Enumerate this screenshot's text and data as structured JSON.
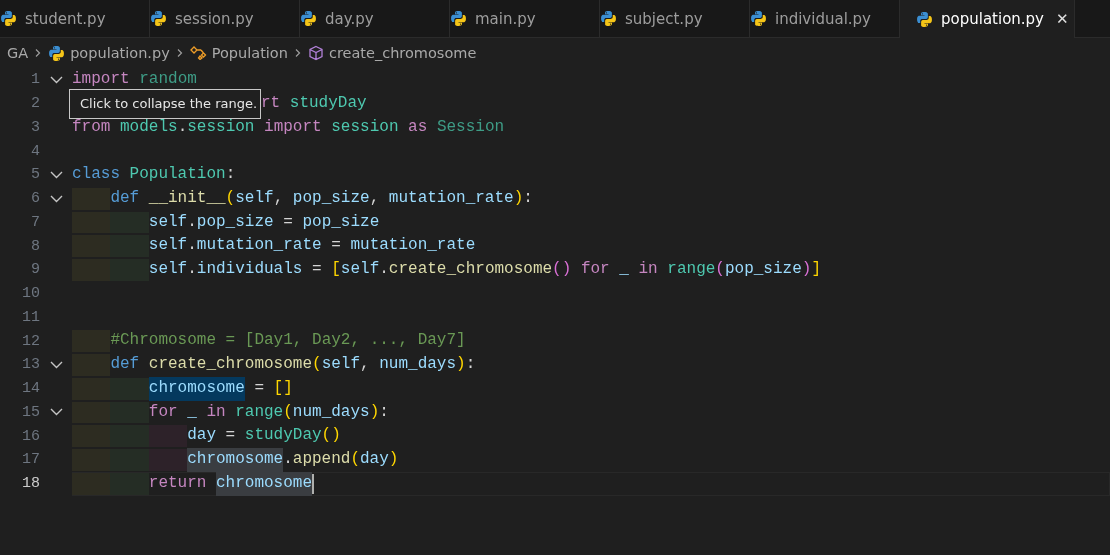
{
  "tabs": [
    {
      "label": "student.py",
      "selected": false
    },
    {
      "label": "session.py",
      "selected": false
    },
    {
      "label": "day.py",
      "selected": false
    },
    {
      "label": "main.py",
      "selected": false
    },
    {
      "label": "subject.py",
      "selected": false
    },
    {
      "label": "individual.py",
      "selected": false
    },
    {
      "label": "population.py",
      "selected": true,
      "close": "✕"
    }
  ],
  "breadcrumb": [
    {
      "kind": "folder",
      "label": "GA"
    },
    {
      "kind": "file",
      "label": "population.py"
    },
    {
      "kind": "class",
      "label": "Population"
    },
    {
      "kind": "method",
      "label": "create_chromosome"
    }
  ],
  "lines": [
    {
      "number": "1",
      "foldable": true,
      "current": false,
      "tokens": [
        {
          "t": "import ",
          "kind": "keyword"
        },
        {
          "t": "random",
          "kind": "dim"
        }
      ]
    },
    {
      "number": "2",
      "foldable": false,
      "current": false,
      "tooltip": "Click to collapse the range.",
      "tokens": [
        {
          "t": "rt ",
          "kind": "keyword"
        },
        {
          "t": "studyDay",
          "kind": "type"
        }
      ]
    },
    {
      "number": "3",
      "foldable": false,
      "current": false,
      "tokens": [
        {
          "t": "from ",
          "kind": "keyword"
        },
        {
          "t": "models",
          "kind": "type"
        },
        {
          "t": ".",
          "kind": "plain"
        },
        {
          "t": "session ",
          "kind": "type"
        },
        {
          "t": "import ",
          "kind": "keyword"
        },
        {
          "t": "session ",
          "kind": "type"
        },
        {
          "t": "as ",
          "kind": "keyword"
        },
        {
          "t": "Session",
          "kind": "dim"
        }
      ]
    },
    {
      "number": "4",
      "foldable": false,
      "current": false
    },
    {
      "number": "5",
      "foldable": true,
      "current": false,
      "tokens": [
        {
          "t": "class ",
          "kind": "storage"
        },
        {
          "t": "Population",
          "kind": "type"
        },
        {
          "t": ":",
          "kind": "plain"
        }
      ],
      "children": [
        {
          "number": "6",
          "foldable": true,
          "current": false,
          "tokens": [
            {
              "t": "def ",
              "kind": "storage"
            },
            {
              "t": "__init__",
              "kind": "func"
            },
            {
              "t": "(",
              "kind": "bracket1"
            },
            {
              "t": "self",
              "kind": "var"
            },
            {
              "t": ", ",
              "kind": "plain"
            },
            {
              "t": "pop_size",
              "kind": "var"
            },
            {
              "t": ", ",
              "kind": "plain"
            },
            {
              "t": "mutation_rate",
              "kind": "var"
            },
            {
              "t": ")",
              "kind": "bracket1"
            },
            {
              "t": ":",
              "kind": "plain"
            }
          ],
          "children": [
            {
              "number": "7",
              "foldable": false,
              "current": false,
              "tokens": [
                {
                  "t": "self",
                  "kind": "var"
                },
                {
                  "t": ".",
                  "kind": "plain"
                },
                {
                  "t": "pop_size",
                  "kind": "var"
                },
                {
                  "t": " = ",
                  "kind": "plain"
                },
                {
                  "t": "pop_size",
                  "kind": "var"
                }
              ]
            },
            {
              "number": "8",
              "foldable": false,
              "current": false,
              "tokens": [
                {
                  "t": "self",
                  "kind": "var"
                },
                {
                  "t": ".",
                  "kind": "plain"
                },
                {
                  "t": "mutation_rate",
                  "kind": "var"
                },
                {
                  "t": " = ",
                  "kind": "plain"
                },
                {
                  "t": "mutation_rate",
                  "kind": "var"
                }
              ]
            },
            {
              "number": "9",
              "foldable": false,
              "current": false,
              "tokens": [
                {
                  "t": "self",
                  "kind": "var"
                },
                {
                  "t": ".",
                  "kind": "plain"
                },
                {
                  "t": "individuals",
                  "kind": "var"
                },
                {
                  "t": " = ",
                  "kind": "plain"
                },
                {
                  "t": "[",
                  "kind": "bracket1"
                },
                {
                  "t": "self",
                  "kind": "var"
                },
                {
                  "t": ".",
                  "kind": "plain"
                },
                {
                  "t": "create_chromosome",
                  "kind": "func"
                },
                {
                  "t": "() ",
                  "kind": "bracket2"
                },
                {
                  "t": "for ",
                  "kind": "keyword"
                },
                {
                  "t": "_ ",
                  "kind": "var"
                },
                {
                  "t": "in ",
                  "kind": "keyword"
                },
                {
                  "t": "range",
                  "kind": "type"
                },
                {
                  "t": "(",
                  "kind": "bracket2"
                },
                {
                  "t": "pop_size",
                  "kind": "var"
                },
                {
                  "t": ")",
                  "kind": "bracket2"
                },
                {
                  "t": "]",
                  "kind": "bracket1"
                }
              ]
            }
          ]
        },
        {
          "number": "10",
          "foldable": false,
          "current": false
        },
        {
          "number": "11",
          "foldable": false,
          "current": false
        },
        {
          "number": "12",
          "foldable": false,
          "current": false,
          "tokens": [
            {
              "t": "#Chromosome = [Day1, Day2, ..., Day7]",
              "kind": "comment"
            }
          ]
        },
        {
          "number": "13",
          "foldable": true,
          "current": false,
          "tokens": [
            {
              "t": "def ",
              "kind": "storage"
            },
            {
              "t": "create_chromosome",
              "kind": "func"
            },
            {
              "t": "(",
              "kind": "bracket1"
            },
            {
              "t": "self",
              "kind": "var"
            },
            {
              "t": ", ",
              "kind": "plain"
            },
            {
              "t": "num_days",
              "kind": "var"
            },
            {
              "t": ")",
              "kind": "bracket1"
            },
            {
              "t": ":",
              "kind": "plain"
            }
          ],
          "children": [
            {
              "number": "14",
              "foldable": false,
              "current": false,
              "tokens": [
                {
                  "t": "chromosome",
                  "kind": "var",
                  "selected": true
                },
                {
                  "t": " = ",
                  "kind": "plain"
                },
                {
                  "t": "[]",
                  "kind": "bracket1"
                }
              ]
            },
            {
              "number": "15",
              "foldable": true,
              "current": false,
              "tokens": [
                {
                  "t": "for ",
                  "kind": "keyword"
                },
                {
                  "t": "_ ",
                  "kind": "var"
                },
                {
                  "t": "in ",
                  "kind": "keyword"
                },
                {
                  "t": "range",
                  "kind": "type"
                },
                {
                  "t": "(",
                  "kind": "bracket1"
                },
                {
                  "t": "num_days",
                  "kind": "var"
                },
                {
                  "t": ")",
                  "kind": "bracket1"
                },
                {
                  "t": ":",
                  "kind": "plain"
                }
              ],
              "children": [
                {
                  "number": "16",
                  "foldable": false,
                  "current": false,
                  "tokens": [
                    {
                      "t": "day",
                      "kind": "var"
                    },
                    {
                      "t": " = ",
                      "kind": "plain"
                    },
                    {
                      "t": "studyDay",
                      "kind": "type"
                    },
                    {
                      "t": "()",
                      "kind": "bracket1"
                    }
                  ]
                },
                {
                  "number": "17",
                  "foldable": false,
                  "current": false,
                  "tokens": [
                    {
                      "t": "chromosome",
                      "kind": "var",
                      "highlighted": true
                    },
                    {
                      "t": ".",
                      "kind": "plain"
                    },
                    {
                      "t": "append",
                      "kind": "func"
                    },
                    {
                      "t": "(",
                      "kind": "bracket1"
                    },
                    {
                      "t": "day",
                      "kind": "var"
                    },
                    {
                      "t": ")",
                      "kind": "bracket1"
                    }
                  ]
                }
              ]
            },
            {
              "number": "18",
              "foldable": false,
              "current": true,
              "tokens": [
                {
                  "t": "return ",
                  "kind": "keyword"
                },
                {
                  "t": "chromosome",
                  "kind": "var",
                  "highlighted": true
                }
              ]
            }
          ]
        }
      ]
    }
  ]
}
